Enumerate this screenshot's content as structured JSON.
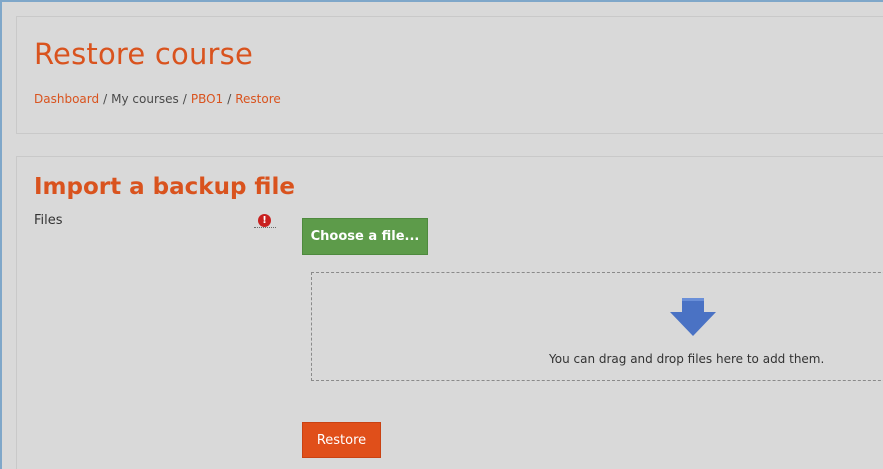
{
  "page": {
    "title": "Restore course"
  },
  "breadcrumb": {
    "items": [
      {
        "label": "Dashboard",
        "link": true
      },
      {
        "label": "My courses",
        "link": false
      },
      {
        "label": "PBO1",
        "link": true
      },
      {
        "label": "Restore",
        "link": true
      }
    ],
    "separator": "/"
  },
  "form": {
    "section_title": "Import a backup file",
    "files_label": "Files",
    "required_icon": "exclamation-icon",
    "required_glyph": "!",
    "choose_button_label": "Choose a file...",
    "dropzone_text": "You can drag and drop files here to add them.",
    "dropzone_icon": "down-arrow-icon",
    "restore_button_label": "Restore"
  },
  "colors": {
    "accent": "#d9531e",
    "choose_button": "#5d9b4a",
    "restore_button": "#e04f1a",
    "arrow": "#4a72c4",
    "required": "#c9201f",
    "background": "#d9d9d9"
  }
}
